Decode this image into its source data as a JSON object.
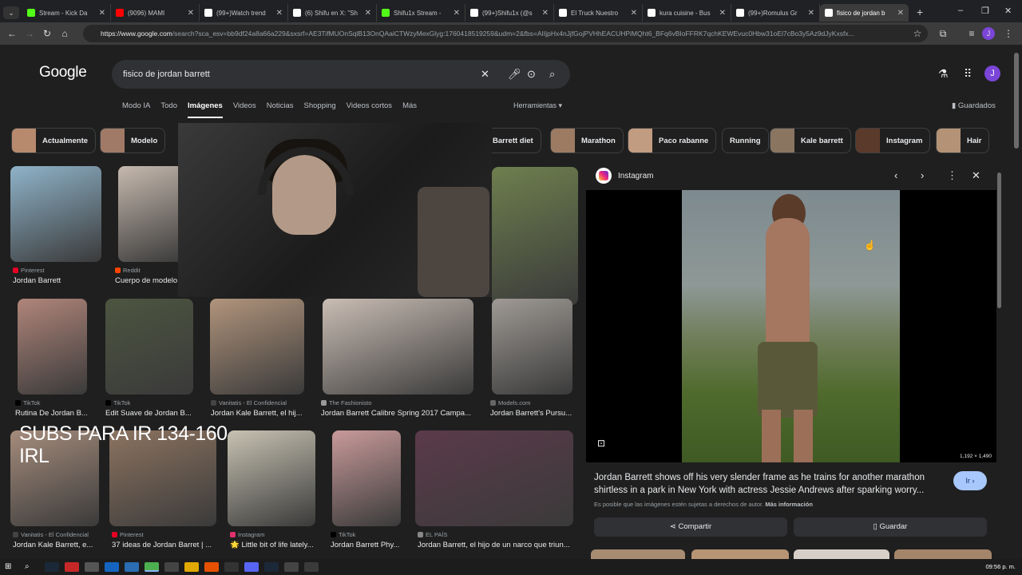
{
  "browser": {
    "tabs": [
      {
        "title": "Stream - Kick Da",
        "color": "#53fc18"
      },
      {
        "title": "(9096) MAMI",
        "color": "#ff0000"
      },
      {
        "title": "(99+)Watch trend",
        "color": "#ffffff"
      },
      {
        "title": "(6) Shifu en X: \"Sh",
        "color": "#ffffff"
      },
      {
        "title": "Shifu1x Stream - ",
        "color": "#53fc18"
      },
      {
        "title": "(99+)Shifu1x (@s",
        "color": "#ffffff"
      },
      {
        "title": "El Truck Nuestro ",
        "color": "#ffffff"
      },
      {
        "title": "kura cuisine - Bus",
        "color": "#ffffff"
      },
      {
        "title": "(99+)Romulus Gr",
        "color": "#ffffff"
      },
      {
        "title": "fisico de jordan b",
        "color": "#ffffff"
      }
    ],
    "url_host": "https://www.google.com",
    "url_rest": "/search?sca_esv=bb9df24a8a66a229&sxsrf=AE3TifMUOnSqlB13OnQAaiCTWzyMexGlyg:1760418519259&udm=2&fbs=AIIjpHx4nJjfGojPVHhEACUHPiMQht6_BFq6vBIoFFRK7qchKEWEvuc0Hbw31oEl7cBo3y5Az9dJyKxsfx..."
  },
  "google": {
    "logo": "Google",
    "query": "fisico de jordan barrett",
    "nav_tabs": [
      "Modo IA",
      "Todo",
      "Imágenes",
      "Videos",
      "Noticias",
      "Shopping",
      "Videos cortos",
      "Más"
    ],
    "tools": "Herramientas",
    "saved": "Guardados",
    "avatar_letter": "J",
    "chips": [
      {
        "label": "Actualmente",
        "thumb": "#b78a6d"
      },
      {
        "label": "Modelo",
        "thumb": "#a07a66"
      },
      {
        "label": "Barrett diet",
        "thumb": ""
      },
      {
        "label": "Marathon",
        "thumb": "#9c7b62"
      },
      {
        "label": "Paco rabanne",
        "thumb": "#c29c80"
      },
      {
        "label": "Running",
        "thumb": ""
      },
      {
        "label": "Kale barrett",
        "thumb": "#8a7561"
      },
      {
        "label": "Instagram",
        "thumb": "#5a3a2a"
      },
      {
        "label": "Hair",
        "thumb": "#b49276"
      }
    ],
    "results": [
      {
        "source": "Pinterest",
        "title": "Jordan Barrett",
        "color": "#8fb3c9",
        "srccolor": "#e60023"
      },
      {
        "source": "Reddit",
        "title": "Cuerpo de modelo",
        "color": "#c6b9ae",
        "srccolor": "#ff4500"
      },
      {
        "source": "Instagram",
        "title": "Jordan Barrett shows...",
        "color": "#6e7f4e",
        "srccolor": "#e1306c"
      },
      {
        "source": "TikTok",
        "title": "Rutina De Jordan B...",
        "color": "#b0857a",
        "srccolor": "#000000"
      },
      {
        "source": "TikTok",
        "title": "Edit Suave de Jordan B...",
        "color": "#4d5540",
        "srccolor": "#000000"
      },
      {
        "source": "Vanitatis - El Confidencial",
        "title": "Jordan Kale Barrett, el hij...",
        "color": "#b1947c",
        "srccolor": "#444444"
      },
      {
        "source": "The Fashionisto",
        "title": "Jordan Barrett Calibre Spring 2017 Campa...",
        "color": "#c9bdb4",
        "srccolor": "#999999"
      },
      {
        "source": "Models.com",
        "title": "Jordan Barrett's Pursu...",
        "color": "#9f9a95",
        "srccolor": "#666666"
      },
      {
        "source": "Vanitatis - El Confidencial",
        "title": "Jordan Kale Barrett, e...",
        "color": "#a58c7c",
        "srccolor": "#444444"
      },
      {
        "source": "Pinterest",
        "title": "37 ideas de Jordan Barret | ...",
        "color": "#8c7360",
        "srccolor": "#e60023"
      },
      {
        "source": "Instagram",
        "title": "🌟 Little bit of life lately...",
        "color": "#c7c2b2",
        "srccolor": "#e1306c"
      },
      {
        "source": "TikTok",
        "title": "Jordan Barrett Phy...",
        "color": "#c99a9a",
        "srccolor": "#000000"
      },
      {
        "source": "EL PAÍS",
        "title": "Jordan Barrett, el hijo de un narco que triun...",
        "color": "#5b3a4a",
        "srccolor": "#888888"
      }
    ],
    "overlay_text_1": "SUBS PARA IR 134-160",
    "overlay_text_2": "IRL"
  },
  "panel": {
    "source": "Instagram",
    "dims": "1,192 × 1,490",
    "title": "Jordan Barrett shows off his very slender frame as he trains for another marathon shirtless in a park in New York with actress Jessie Andrews after sparking worry...",
    "ir": "Ir",
    "copyright": "Es posible que las imágenes estén sujetas a derechos de autor.",
    "more_info": "Más información",
    "share": "Compartir",
    "save": "Guardar"
  },
  "taskbar": {
    "time": "09:56 p. m."
  }
}
